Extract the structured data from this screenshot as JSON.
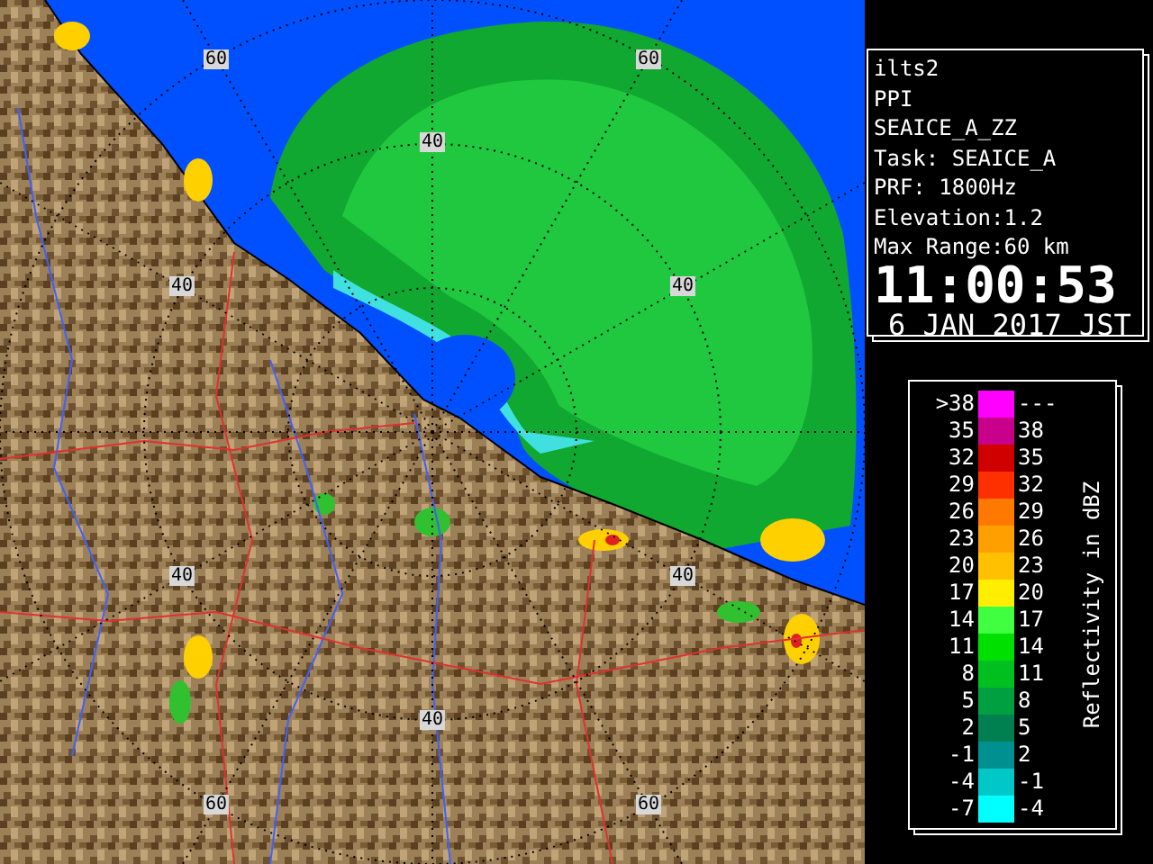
{
  "map": {
    "range_labels": [
      "60",
      "60",
      "40",
      "40",
      "40",
      "40",
      "40",
      "40",
      "60",
      "60"
    ]
  },
  "info": {
    "lines": [
      "ilts2",
      "PPI",
      "SEAICE_A_ZZ",
      "Task: SEAICE_A",
      "PRF: 1800Hz",
      "Elevation:1.2",
      "Max Range:60 km"
    ],
    "time": "11:00:53",
    "date": "6 JAN 2017 JST"
  },
  "legend": {
    "title": "Reflectivity in dBZ",
    "rows": [
      {
        "low": ">38",
        "high": "---",
        "color": "#ff00ff"
      },
      {
        "low": "35",
        "high": "38",
        "color": "#c8008a"
      },
      {
        "low": "32",
        "high": "35",
        "color": "#d00000"
      },
      {
        "low": "29",
        "high": "32",
        "color": "#ff3000"
      },
      {
        "low": "26",
        "high": "29",
        "color": "#ff7800"
      },
      {
        "low": "23",
        "high": "26",
        "color": "#ffa000"
      },
      {
        "low": "20",
        "high": "23",
        "color": "#ffc000"
      },
      {
        "low": "17",
        "high": "20",
        "color": "#ffee00"
      },
      {
        "low": "14",
        "high": "17",
        "color": "#40ff40"
      },
      {
        "low": "11",
        "high": "14",
        "color": "#00e000"
      },
      {
        "low": "8",
        "high": "11",
        "color": "#00c020"
      },
      {
        "low": "5",
        "high": "8",
        "color": "#00a040"
      },
      {
        "low": "2",
        "high": "5",
        "color": "#008050"
      },
      {
        "low": "-1",
        "high": "2",
        "color": "#009090"
      },
      {
        "low": "-4",
        "high": "-1",
        "color": "#00c8c8"
      },
      {
        "low": "-7",
        "high": "-4",
        "color": "#00ffff"
      }
    ]
  }
}
